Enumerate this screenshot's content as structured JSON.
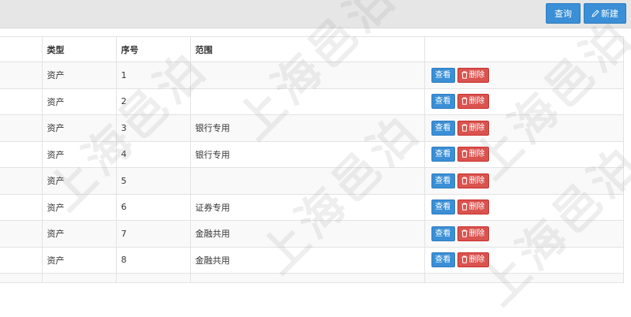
{
  "toolbar": {
    "query_label": "查询",
    "new_label": "新建"
  },
  "table": {
    "columns": [
      "类型",
      "序号",
      "范围",
      ""
    ],
    "rows": [
      {
        "type": "资产",
        "seq": "1",
        "scope": ""
      },
      {
        "type": "资产",
        "seq": "2",
        "scope": ""
      },
      {
        "type": "资产",
        "seq": "3",
        "scope": "银行专用"
      },
      {
        "type": "资产",
        "seq": "4",
        "scope": "银行专用"
      },
      {
        "type": "资产",
        "seq": "5",
        "scope": ""
      },
      {
        "type": "资产",
        "seq": "6",
        "scope": "证券专用"
      },
      {
        "type": "资产",
        "seq": "7",
        "scope": "金融共用"
      },
      {
        "type": "资产",
        "seq": "8",
        "scope": "金融共用"
      }
    ],
    "actions": {
      "view_label": "查看",
      "delete_label": "删除"
    }
  },
  "watermark": {
    "text": "上海邑泊"
  },
  "colors": {
    "primary": "#3a8fd6",
    "danger": "#d9534f",
    "toolbar_bg": "#e6e6e6"
  },
  "icons": {
    "new": "pencil-icon",
    "delete": "trash-icon"
  }
}
